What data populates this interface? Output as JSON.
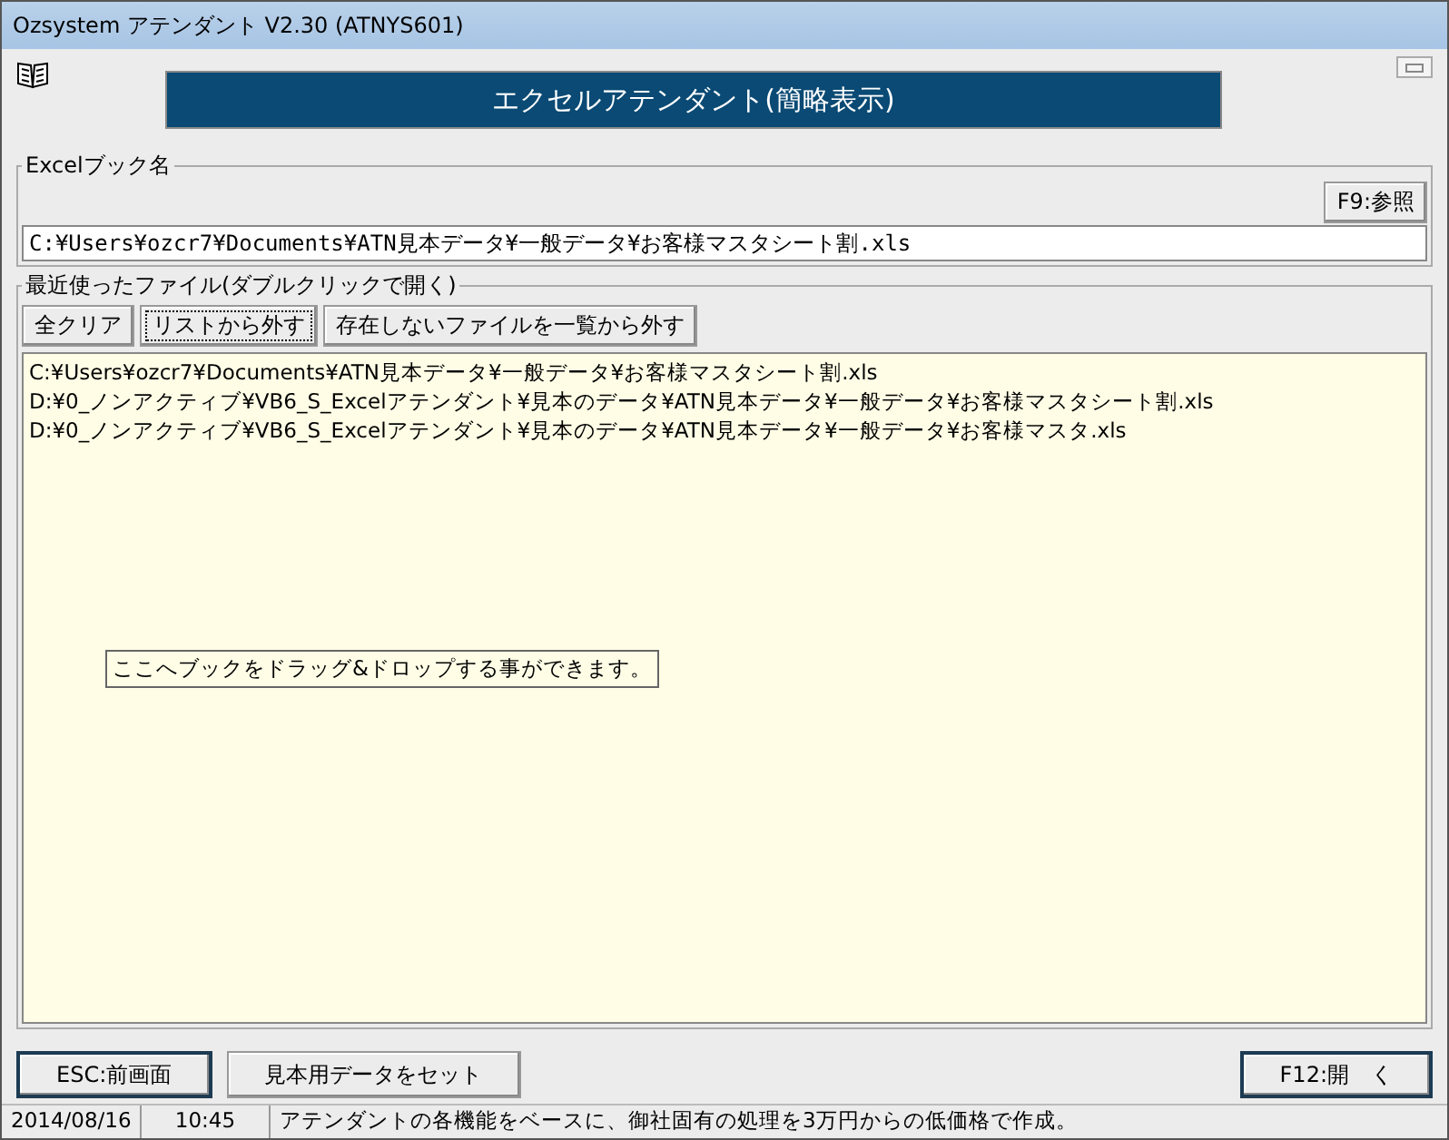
{
  "window": {
    "title": "Ozsystem アテンダント V2.30 (ATNYS601)"
  },
  "banner": "エクセルアテンダント(簡略表示)",
  "excel_book": {
    "legend": "Excelブック名",
    "browse_button": "F9:参照",
    "value": "C:¥Users¥ozcr7¥Documents¥ATN見本データ¥一般データ¥お客様マスタシート割.xls"
  },
  "recent": {
    "legend": "最近使ったファイル(ダブルクリックで開く)",
    "buttons": [
      {
        "label": "全クリア",
        "focused": false
      },
      {
        "label": "リストから外す",
        "focused": true
      },
      {
        "label": "存在しないファイルを一覧から外す",
        "focused": false
      }
    ],
    "files": [
      "C:¥Users¥ozcr7¥Documents¥ATN見本データ¥一般データ¥お客様マスタシート割.xls",
      "D:¥0_ノンアクティブ¥VB6_S_Excelアテンダント¥見本のデータ¥ATN見本データ¥一般データ¥お客様マスタシート割.xls",
      "D:¥0_ノンアクティブ¥VB6_S_Excelアテンダント¥見本のデータ¥ATN見本データ¥一般データ¥お客様マスタ.xls"
    ],
    "drop_hint": "ここへブックをドラッグ&ドロップする事ができます。"
  },
  "footer_buttons": [
    {
      "label": "ESC:前画面",
      "default": true
    },
    {
      "label": "見本用データをセット",
      "default": false
    },
    {
      "label": "F12:開　く",
      "default": true
    }
  ],
  "status_bar": [
    "2014/08/16",
    "10:45",
    "アテンダントの各機能をベースに、御社固有の処理を3万円からの低価格で作成。"
  ]
}
